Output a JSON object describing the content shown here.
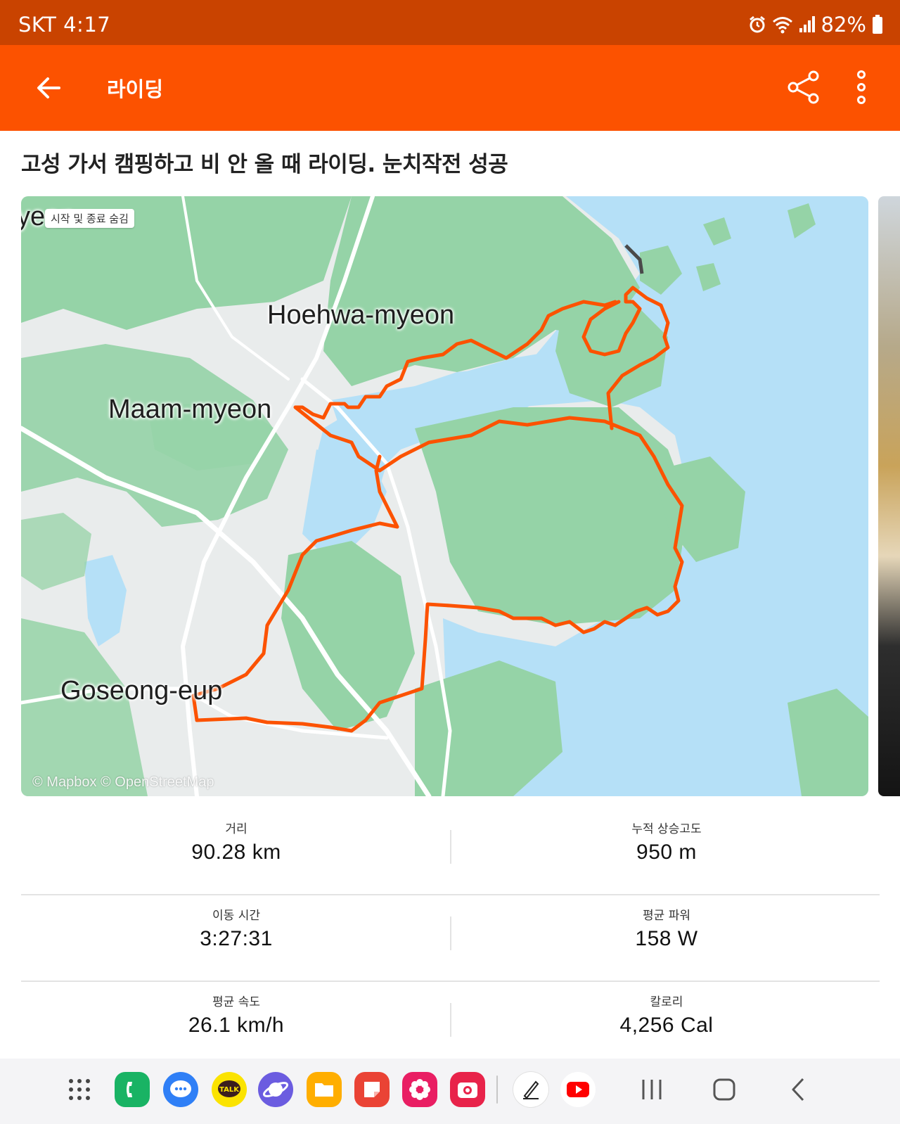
{
  "status_bar": {
    "carrier_time": "SKT 4:17",
    "battery": "82%",
    "icons": [
      "alarm-icon",
      "wifi-icon",
      "signal-icon",
      "battery-icon"
    ]
  },
  "app_bar": {
    "title": "라이딩",
    "icons": [
      "back-arrow-icon",
      "share-icon",
      "more-vert-icon"
    ]
  },
  "activity": {
    "title": "고성 가서 캠핑하고 비 안 올 때 라이딩. 눈치작전 성공"
  },
  "map": {
    "toggle_label": "시작 및 종료 숨김",
    "cut_label": "yeon",
    "places": {
      "hoehwa": "Hoehwa-myeon",
      "maam": "Maam-myeon",
      "goseong": "Goseong-eup"
    },
    "attribution": "© Mapbox © OpenStreetMap",
    "route_color": "#fc5200",
    "water_color": "#b5e0f7",
    "land_color": "#e9ecec",
    "forest_color": "#95d3a7"
  },
  "stats": [
    {
      "left": {
        "label": "거리",
        "value": "90.28 km"
      },
      "right": {
        "label": "누적 상승고도",
        "value": "950 m"
      }
    },
    {
      "left": {
        "label": "이동 시간",
        "value": "3:27:31"
      },
      "right": {
        "label": "평균 파워",
        "value": "158 W"
      }
    },
    {
      "left": {
        "label": "평균 속도",
        "value": "26.1 km/h"
      },
      "right": {
        "label": "칼로리",
        "value": "4,256 Cal"
      }
    }
  ],
  "taskbar": {
    "apps": [
      "app-drawer-icon",
      "phone-app-icon",
      "messages-app-icon",
      "kakaotalk-app-icon",
      "internet-app-icon",
      "my-files-app-icon",
      "notes-app-icon",
      "gallery-app-icon",
      "camera-app-icon",
      "pen-app-icon",
      "youtube-app-icon"
    ],
    "talk_label": "TALK",
    "nav": [
      "recents-icon",
      "home-icon",
      "nav-back-icon"
    ]
  }
}
